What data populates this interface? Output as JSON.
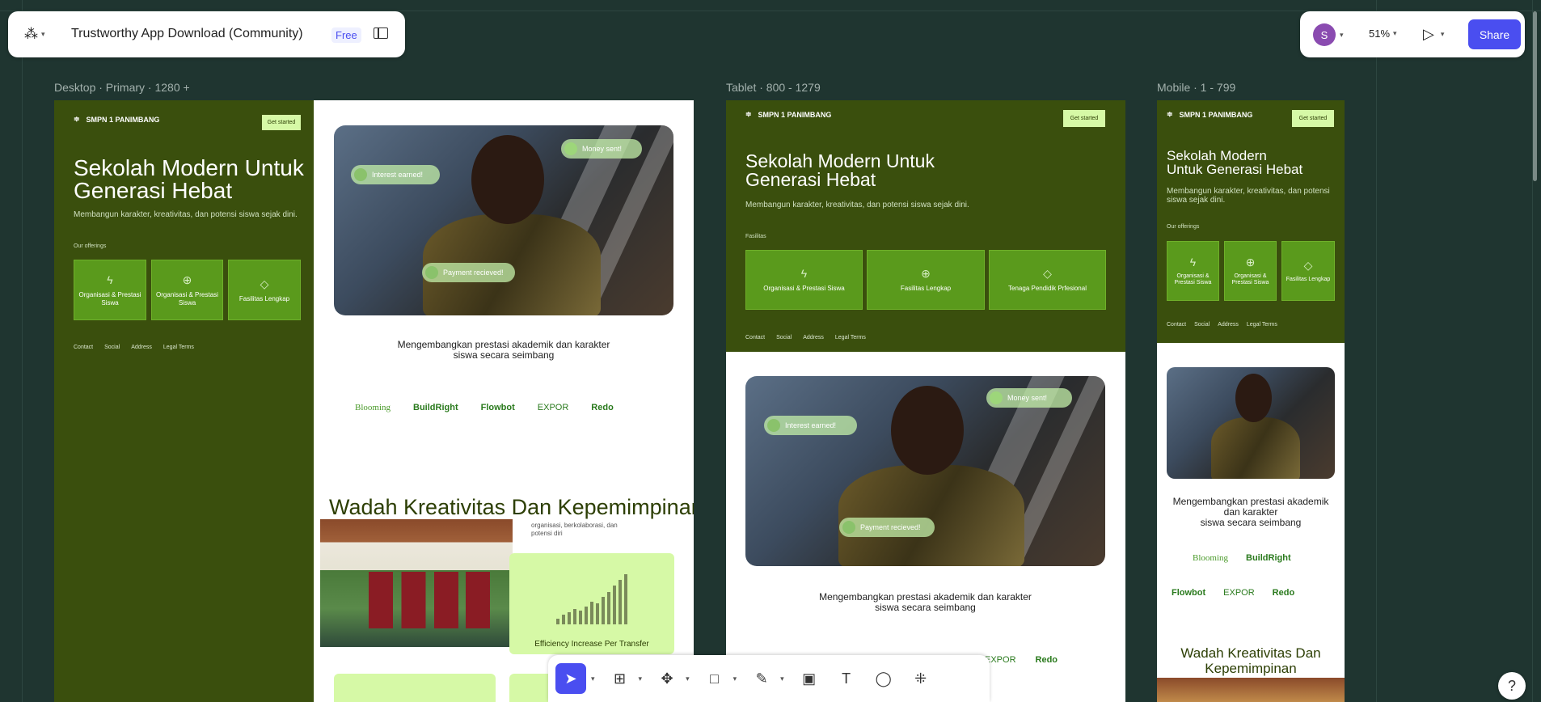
{
  "app": {
    "file_title": "Trustworthy App Download (Community)",
    "plan_badge": "Free",
    "avatar_initial": "S",
    "zoom": "51%",
    "share_label": "Share",
    "help_label": "?"
  },
  "frames": {
    "desktop_label": "Desktop · Primary · 1280 +",
    "tablet_label": "Tablet · 800 - 1279",
    "mobile_label": "Mobile · 1 - 799"
  },
  "site": {
    "school_name": "SMPN 1 PANIMBANG",
    "cta": "Get started",
    "hero_title_line1": "Sekolah Modern Untuk",
    "hero_title_line2": "Generasi Hebat",
    "mobile_title_line1": "Sekolah Modern",
    "mobile_title_line2": "Untuk Generasi Hebat",
    "hero_sub": "Membangun karakter, kreativitas, dan potensi siswa sejak dini.",
    "mobile_sub_line1": "Membangun karakter, kreativitas, dan potensi",
    "mobile_sub_line2": "siswa sejak dini.",
    "offerings_label": "Our offerings",
    "fasilitas_label": "Fasilitas",
    "desktop_cards": [
      "Organisasi & Prestasi Siswa",
      "Organisasi & Prestasi Siswa",
      "Fasilitas Lengkap"
    ],
    "tablet_cards": [
      "Organisasi & Prestasi Siswa",
      "Fasilitas Lengkap",
      "Tenaga Pendidik Prfesional"
    ],
    "mobile_cards": [
      "Organisasi & Prestasi Siswa",
      "Organisasi & Prestasi Siswa",
      "Fasilitas Lengkap"
    ],
    "footer_links": [
      "Contact",
      "Social",
      "Address",
      "Legal Terms"
    ],
    "pill_interest": "Interest earned!",
    "pill_money": "Money sent!",
    "pill_payment": "Payment recieved!",
    "tagline_line1": "Mengembangkan prestasi akademik dan karakter",
    "tagline_line2": "siswa secara seimbang",
    "mobile_tagline_line1": "Mengembangkan prestasi akademik",
    "mobile_tagline_line2": "dan karakter",
    "mobile_tagline_line3": "siswa secara seimbang",
    "logos": [
      "Blooming",
      "BuildRight",
      "Flowbot",
      "EXPOR",
      "Redo"
    ],
    "section_title": "Wadah Kreativitas Dan Kepemimpinan",
    "mobile_section_line1": "Wadah Kreativitas Dan",
    "mobile_section_line2": "Kepemimpinan",
    "section_sub_line1": "organisasi, berkolaborasi, dan",
    "section_sub_line2": "potensi diri",
    "chart_caption": "Efficiency Increase Per Transfer"
  },
  "icons": {
    "menu": "figma-menu-icon",
    "sidebar": "sidebar-toggle-icon",
    "present": "play-icon",
    "move": "move-tool-icon",
    "frame": "frame-tool-icon",
    "component": "component-tool-icon",
    "rect": "rectangle-tool-icon",
    "pen": "pen-tool-icon",
    "image": "image-tool-icon",
    "text": "text-tool-icon",
    "comment": "comment-tool-icon",
    "actions": "actions-tool-icon"
  },
  "colors": {
    "accent": "#4a4ef0",
    "site_dark": "#3a4f0d",
    "site_card": "#5a9a1c",
    "canvas": "#1f3530"
  }
}
